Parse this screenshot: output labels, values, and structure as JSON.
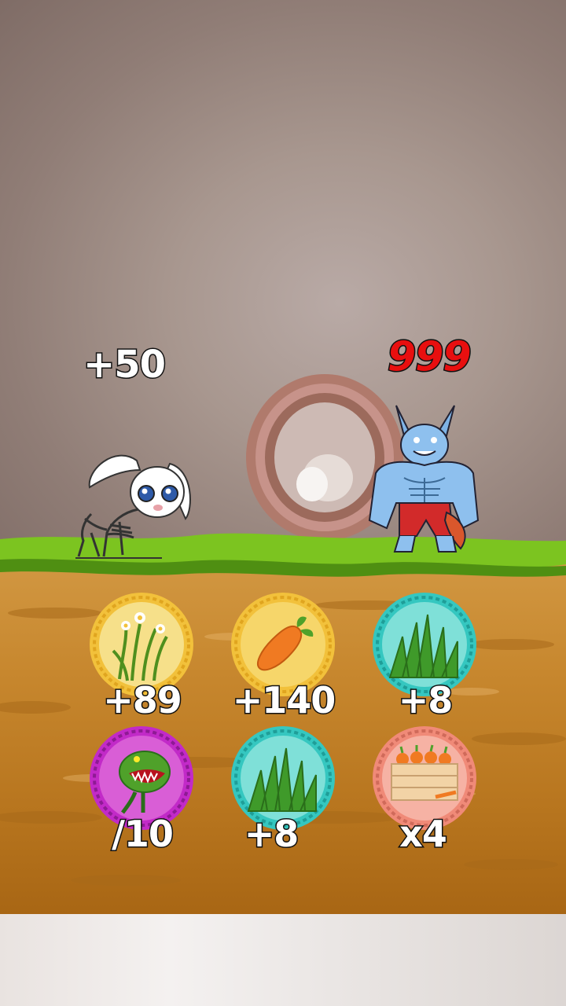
{
  "hud": {
    "player_score": "+50",
    "enemy_score": "999"
  },
  "colors": {
    "player_score": "#ffffff",
    "enemy_score": "#e80f0f",
    "gold_ring": "#f2c13b",
    "teal_ring": "#35c7c0",
    "magenta_ring": "#c22ac8",
    "salmon_ring": "#f08a78"
  },
  "characters": {
    "player": {
      "icon": "skeletal-rabbit-icon"
    },
    "enemy": {
      "icon": "muscular-wolf-icon"
    }
  },
  "pickups": [
    {
      "label": "+89",
      "icon": "grass-with-flowers-icon",
      "ring": "gold"
    },
    {
      "label": "+140",
      "icon": "carrot-icon",
      "ring": "gold"
    },
    {
      "label": "+8",
      "icon": "grass-tuft-icon",
      "ring": "teal"
    },
    {
      "label": "/10",
      "icon": "carnivorous-plant-icon",
      "ring": "magenta"
    },
    {
      "label": "+8",
      "icon": "grass-tuft-icon",
      "ring": "teal"
    },
    {
      "label": "x4",
      "icon": "carrot-crate-icon",
      "ring": "salmon"
    }
  ]
}
